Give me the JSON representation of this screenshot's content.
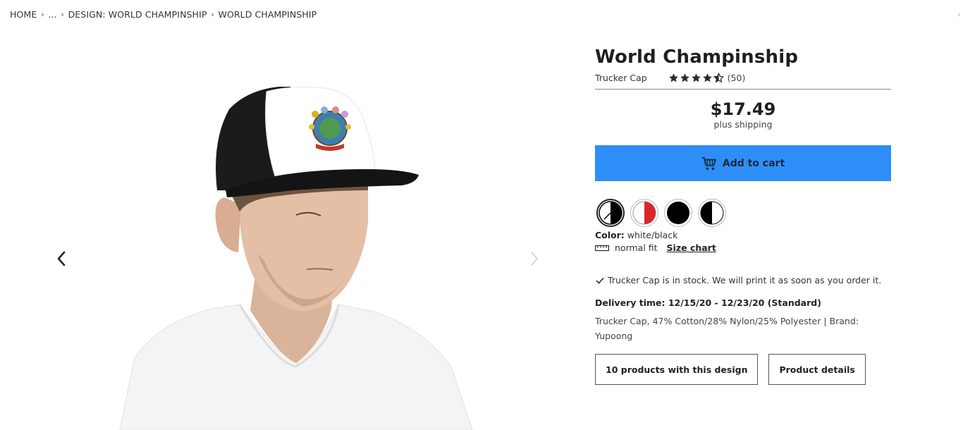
{
  "breadcrumb": {
    "items": [
      "HOME",
      "...",
      "DESIGN: WORLD CHAMPINSHIP",
      "WORLD CHAMPINSHIP"
    ]
  },
  "product": {
    "title": "World Champinship",
    "type": "Trucker Cap",
    "rating": 4.5,
    "review_count": "(50)",
    "price": "$17.49",
    "shipping": "plus shipping",
    "add_to_cart": "Add to cart",
    "color_label": "Color:",
    "color_value": "white/black",
    "fit": "normal fit",
    "size_chart": "Size chart",
    "stock": "Trucker Cap is in stock. We will print it as soon as you order it.",
    "delivery": "Delivery time: 12/15/20 - 12/23/20 (Standard)",
    "details": "Trucker Cap, 47% Cotton/28% Nylon/25% Polyester | Brand: Yupoong",
    "products_with_design": "10 products with this design",
    "product_details": "Product details"
  },
  "swatches": [
    {
      "name": "white/black",
      "colors": [
        "#ffffff",
        "#000000"
      ],
      "selected": true
    },
    {
      "name": "white/red",
      "colors": [
        "#ffffff",
        "#d9262b"
      ],
      "selected": false
    },
    {
      "name": "black",
      "colors": [
        "#000000",
        "#000000"
      ],
      "selected": false
    },
    {
      "name": "white/black half",
      "colors": [
        "#ffffff",
        "#000000"
      ],
      "selected": false
    }
  ],
  "colors": {
    "accent": "#2e8ef7",
    "text": "#222222"
  },
  "icons": [
    "chevron-right-icon",
    "chevron-left-icon",
    "star-icon",
    "cart-icon",
    "ruler-icon",
    "checkmark-icon"
  ]
}
